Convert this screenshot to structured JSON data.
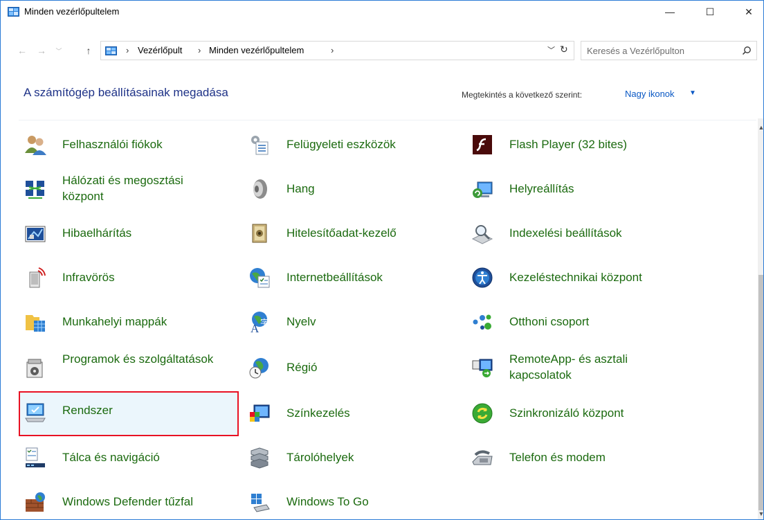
{
  "window": {
    "title": "Minden vezérlőpultelem",
    "controls": {
      "minimize": "—",
      "maximize": "☐",
      "close": "✕"
    }
  },
  "address": {
    "breadcrumbs": [
      "Vezérlőpult",
      "Minden vezérlőpultelem"
    ],
    "search_placeholder": "Keresés a Vezérlőpulton"
  },
  "header": {
    "title": "A számítógép beállításainak megadása",
    "view_label": "Megtekintés a következő szerint:",
    "view_value": "Nagy ikonok"
  },
  "colors": {
    "accent": "#0a58c4",
    "link_green": "#1b6a0f",
    "heading_blue": "#1e3287",
    "selection_border": "#e81123"
  },
  "items": [
    {
      "label": "Felhasználói fiókok",
      "icon": "user-accounts-icon"
    },
    {
      "label": "Felügyeleti eszközök",
      "icon": "admin-tools-icon"
    },
    {
      "label": "Flash Player (32 bites)",
      "icon": "flash-player-icon"
    },
    {
      "label": "Hálózati és megosztási központ",
      "icon": "network-center-icon"
    },
    {
      "label": "Hang",
      "icon": "sound-icon"
    },
    {
      "label": "Helyreállítás",
      "icon": "recovery-icon"
    },
    {
      "label": "Hibaelhárítás",
      "icon": "troubleshooting-icon"
    },
    {
      "label": "Hitelesítőadat-kezelő",
      "icon": "credential-manager-icon"
    },
    {
      "label": "Indexelési beállítások",
      "icon": "indexing-icon"
    },
    {
      "label": "Infravörös",
      "icon": "infrared-icon"
    },
    {
      "label": "Internetbeállítások",
      "icon": "internet-options-icon"
    },
    {
      "label": "Kezeléstechnikai központ",
      "icon": "ease-of-access-icon"
    },
    {
      "label": "Munkahelyi mappák",
      "icon": "work-folders-icon"
    },
    {
      "label": "Nyelv",
      "icon": "language-icon"
    },
    {
      "label": "Otthoni csoport",
      "icon": "homegroup-icon"
    },
    {
      "label": "Programok és szolgáltatások",
      "icon": "programs-icon"
    },
    {
      "label": "Régió",
      "icon": "region-icon"
    },
    {
      "label": "RemoteApp- és asztali kapcsolatok",
      "icon": "remoteapp-icon"
    },
    {
      "label": "Rendszer",
      "icon": "system-icon",
      "selected": true
    },
    {
      "label": "Színkezelés",
      "icon": "color-management-icon"
    },
    {
      "label": "Szinkronizáló központ",
      "icon": "sync-center-icon"
    },
    {
      "label": "Tálca és navigáció",
      "icon": "taskbar-icon"
    },
    {
      "label": "Tárolóhelyek",
      "icon": "storage-spaces-icon"
    },
    {
      "label": "Telefon és modem",
      "icon": "phone-modem-icon"
    },
    {
      "label": "Windows Defender tűzfal",
      "icon": "firewall-icon"
    },
    {
      "label": "Windows To Go",
      "icon": "windows-to-go-icon"
    }
  ]
}
